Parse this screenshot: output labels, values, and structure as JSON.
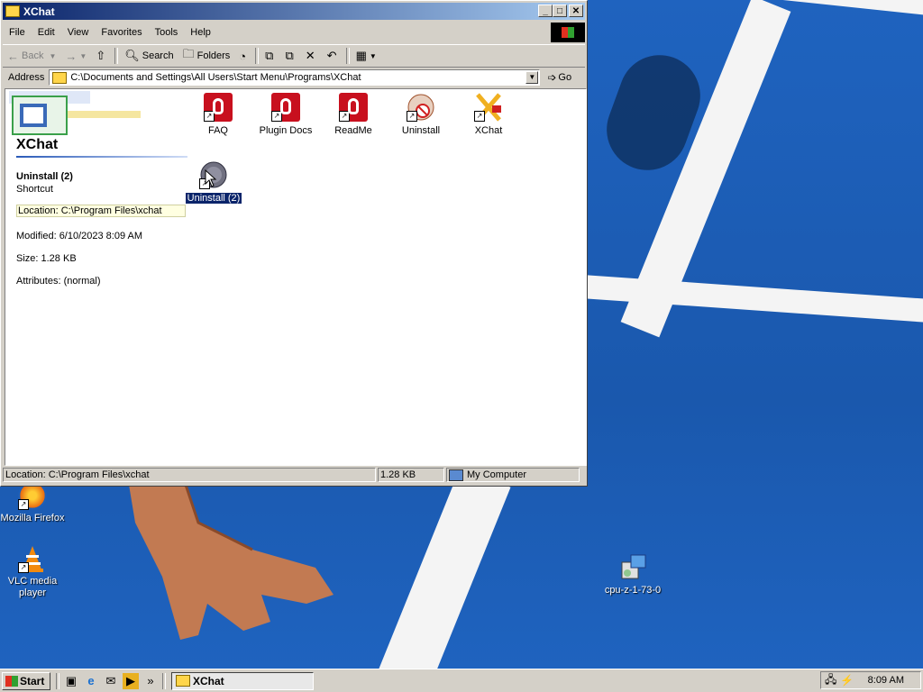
{
  "window": {
    "title": "XChat",
    "controls": {
      "minimize": "_",
      "maximize": "□",
      "close": "✕"
    }
  },
  "menu": [
    "File",
    "Edit",
    "View",
    "Favorites",
    "Tools",
    "Help"
  ],
  "toolbar": {
    "back": "Back",
    "search": "Search",
    "folders": "Folders"
  },
  "address": {
    "label": "Address",
    "path": "C:\\Documents and Settings\\All Users\\Start Menu\\Programs\\XChat",
    "go": "Go"
  },
  "panel": {
    "folder_title": "XChat",
    "selected_name": "Uninstall (2)",
    "selected_type": "Shortcut",
    "location": "Location: C:\\Program Files\\xchat",
    "modified": "Modified: 6/10/2023 8:09 AM",
    "size": "Size: 1.28 KB",
    "attributes": "Attributes: (normal)"
  },
  "files": [
    {
      "name": "FAQ",
      "icon": "document-icon"
    },
    {
      "name": "Plugin Docs",
      "icon": "document-icon"
    },
    {
      "name": "ReadMe",
      "icon": "document-icon"
    },
    {
      "name": "Uninstall",
      "icon": "uninstall-icon"
    },
    {
      "name": "XChat",
      "icon": "xchat-icon"
    },
    {
      "name": "Uninstall (2)",
      "icon": "uninstall-gray-icon",
      "selected": true
    }
  ],
  "status": {
    "location": "Location: C:\\Program Files\\xchat",
    "size": "1.28 KB",
    "zone": "My Computer"
  },
  "desktop_icons": [
    {
      "name": "Mozilla Firefox",
      "icon": "firefox-icon"
    },
    {
      "name": "VLC media player",
      "icon": "vlc-icon"
    },
    {
      "name": "cpu-z-1-73-0",
      "icon": "installer-icon"
    }
  ],
  "taskbar": {
    "start": "Start",
    "task": "XChat",
    "clock": "8:09 AM",
    "more": "»"
  },
  "colors": {
    "titlebar_start": "#0a246a",
    "titlebar_end": "#a6caf0",
    "face": "#d4d0c8",
    "selection": "#0a246a",
    "desktop": "#1d5fb8"
  }
}
